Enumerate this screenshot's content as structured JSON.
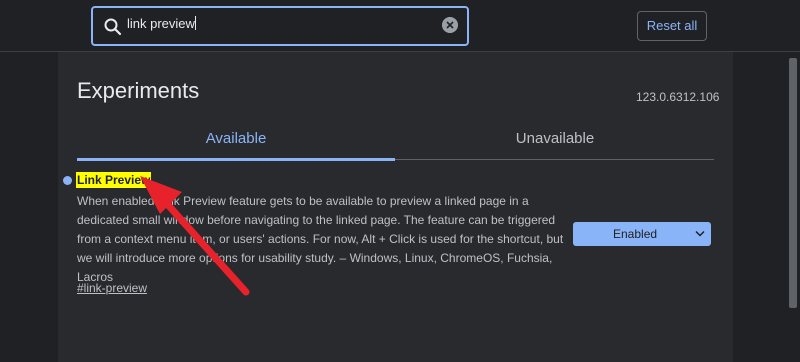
{
  "search": {
    "value": "link preview"
  },
  "toolbar": {
    "reset_label": "Reset all"
  },
  "header": {
    "title": "Experiments",
    "version": "123.0.6312.106"
  },
  "tabs": [
    {
      "label": "Available",
      "selected": true
    },
    {
      "label": "Unavailable",
      "selected": false
    }
  ],
  "experiment": {
    "name": "Link Preview",
    "description": "When enabled Link Preview feature gets to be available to preview a linked page in a dedicated small window before navigating to the linked page. The feature can be triggered from a context menu item, or users' actions. For now, Alt + Click is used for the shortcut, but we will introduce more options for usability study. – Windows, Linux, ChromeOS, Fuchsia, Lacros",
    "anchor": "#link-preview",
    "state": "Enabled"
  },
  "colors": {
    "accent": "#8ab4f8",
    "highlight": "#ffff00",
    "annotation_arrow": "#e8222b"
  }
}
